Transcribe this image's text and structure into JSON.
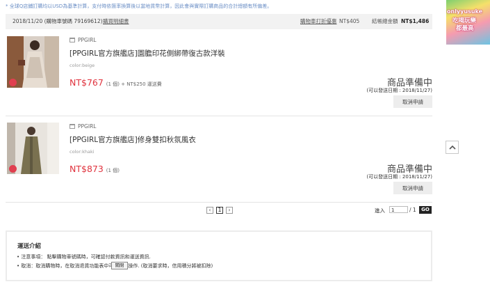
{
  "notice": "* 全球Q店鋪訂購均以USD為基準計算，支付時依匯率換算後以當地貨幣計算，因此會與實際訂購商品的合計總額有所偏差。",
  "order": {
    "date_number": "2018/11/20 (購物車號碼 79169612)",
    "detail_link": "購買明細書",
    "discount_label": "購物車打折優惠",
    "discount_amount": "NT$405",
    "total_label": "結帳總金額",
    "total_amount": "NT$1,486"
  },
  "items": [
    {
      "shop": "PPGIRL",
      "title": "[PPGIRL官方旗艦店]園膽印花側綁帶復古款洋裝",
      "option": "color:beige",
      "price": "NT$767",
      "qty_shipping": "(1 個) + NT$250 運送費",
      "status": "商品準備中",
      "ship_date": "(可以發送日期 : 2018/11/27)",
      "cancel_label": "取消申請"
    },
    {
      "shop": "PPGIRL",
      "title": "[PPGIRL官方旗艦店]修身雙扣秋氛風衣",
      "option": "color:khaki",
      "price": "NT$873",
      "qty_shipping": "(1 個)",
      "status": "商品準備中",
      "ship_date": "(可以發送日期 : 2018/11/27)",
      "cancel_label": "取消申請"
    }
  ],
  "pagination": {
    "prev": "‹",
    "current": "1",
    "next": "›",
    "jump_label": "進入",
    "jump_value": "1",
    "total": "/ 1",
    "go_label": "GO"
  },
  "shipping": {
    "title": "運送介紹",
    "lines": [
      "• 注意事項： 點擊購物車號碼時，可確認付款資訊和運送資訊.",
      "• 取消：取消購物時，在取消退貨功能表中可使用此操作. (取消要求時，信用積分將被扣除)"
    ],
    "tooltip": "關閉"
  },
  "ad": {
    "line1": "onlyyusuke",
    "line2": "吃喝玩樂",
    "line3": "都最高"
  },
  "colors": {
    "price_red": "#e0333e",
    "notice_blue": "#6a8ec5",
    "header_gray": "#f2f2f2"
  },
  "icons": {
    "shop": "shop-icon",
    "back_to_top": "chevron-up-icon"
  }
}
